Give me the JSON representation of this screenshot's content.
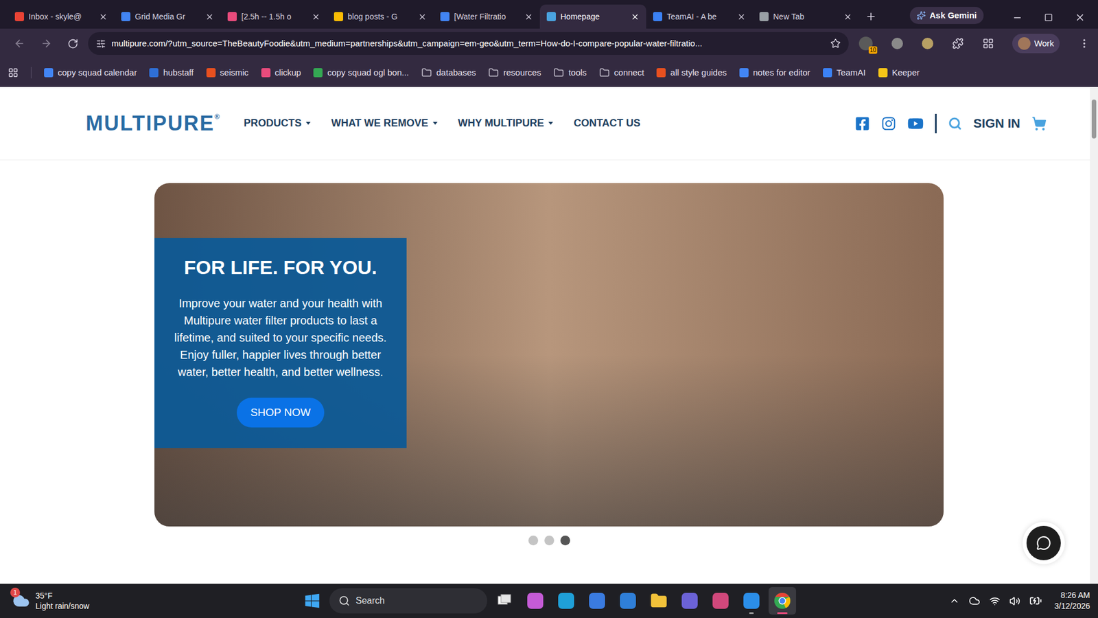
{
  "browser": {
    "tabs": [
      {
        "label": "Inbox - skyle@",
        "selected": false,
        "color": "#ea4335"
      },
      {
        "label": "Grid Media Gr",
        "selected": false,
        "color": "#4285f4"
      },
      {
        "label": "[2.5h -- 1.5h o",
        "selected": false,
        "color": "#e94b7c"
      },
      {
        "label": "blog posts - G",
        "selected": false,
        "color": "#fbbc04"
      },
      {
        "label": "[Water Filtratio",
        "selected": false,
        "color": "#4285f4"
      },
      {
        "label": "Homepage",
        "selected": true,
        "color": "#4aa3df"
      },
      {
        "label": "TeamAI - A be",
        "selected": false,
        "color": "#3b82f6"
      },
      {
        "label": "New Tab",
        "selected": false,
        "color": "#9aa0a6"
      }
    ],
    "gemini": "Ask Gemini",
    "url": "multipure.com/?utm_source=TheBeautyFoodie&utm_medium=partnerships&utm_campaign=em-geo&utm_term=How-do-I-compare-popular-water-filtratio...",
    "extension_badge": "10",
    "profile": "Work",
    "bookmarks": [
      {
        "label": "copy squad calendar",
        "kind": "site",
        "color": "#4285f4"
      },
      {
        "label": "hubstaff",
        "kind": "site",
        "color": "#2f6fd6"
      },
      {
        "label": "seismic",
        "kind": "site",
        "color": "#e8501f"
      },
      {
        "label": "clickup",
        "kind": "site",
        "color": "#e94b7c"
      },
      {
        "label": "copy squad ogl bon...",
        "kind": "site",
        "color": "#34a853"
      },
      {
        "label": "databases",
        "kind": "folder",
        "color": "#c8c3d0"
      },
      {
        "label": "resources",
        "kind": "folder",
        "color": "#c8c3d0"
      },
      {
        "label": "tools",
        "kind": "folder",
        "color": "#c8c3d0"
      },
      {
        "label": "connect",
        "kind": "folder",
        "color": "#c8c3d0"
      },
      {
        "label": "all style guides",
        "kind": "site",
        "color": "#e8501f"
      },
      {
        "label": "notes for editor",
        "kind": "site",
        "color": "#4285f4"
      },
      {
        "label": "TeamAI",
        "kind": "site",
        "color": "#3b82f6"
      },
      {
        "label": "Keeper",
        "kind": "site",
        "color": "#f5c518"
      }
    ]
  },
  "page": {
    "logo": "MULTIPURE",
    "logo_mark": "®",
    "nav": [
      {
        "label": "PRODUCTS",
        "dropdown": true
      },
      {
        "label": "WHAT WE REMOVE",
        "dropdown": true
      },
      {
        "label": "WHY MULTIPURE",
        "dropdown": true
      },
      {
        "label": "CONTACT US",
        "dropdown": false
      }
    ],
    "sign_in": "SIGN IN",
    "hero": {
      "title": "FOR LIFE. FOR YOU.",
      "body": "Improve your water and your health with Multipure water filter products to last a lifetime, and suited to your specific needs. Enjoy fuller, happier lives through better water, better health, and better wellness.",
      "button": "SHOP NOW",
      "dots": [
        {
          "selected": false
        },
        {
          "selected": false
        },
        {
          "selected": true
        }
      ]
    }
  },
  "taskbar": {
    "weather": {
      "temp": "35°F",
      "condition": "Light rain/snow",
      "badge": "1"
    },
    "search": "Search",
    "apps": [
      {
        "kind": "taskview",
        "open": false,
        "active": false
      },
      {
        "kind": "copilot",
        "open": false,
        "active": false
      },
      {
        "kind": "edge",
        "open": false,
        "active": false
      },
      {
        "kind": "store",
        "open": false,
        "active": false
      },
      {
        "kind": "outlook",
        "open": false,
        "active": false
      },
      {
        "kind": "files",
        "open": false,
        "active": false
      },
      {
        "kind": "teams",
        "open": false,
        "active": false
      },
      {
        "kind": "m365",
        "open": false,
        "active": false
      },
      {
        "kind": "hub",
        "open": true,
        "active": false
      },
      {
        "kind": "chrome",
        "open": true,
        "active": true
      }
    ],
    "time": "8:26 AM",
    "date": "3/12/2026"
  }
}
